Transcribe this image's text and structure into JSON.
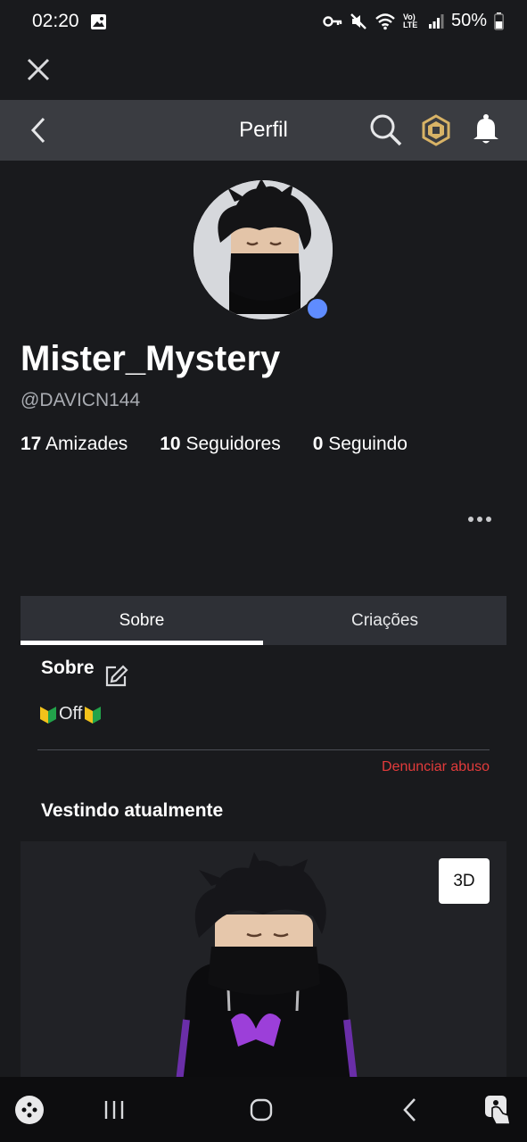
{
  "status": {
    "time": "02:20",
    "network": "Vo) LTE",
    "battery": "50%"
  },
  "header": {
    "title": "Perfil"
  },
  "profile": {
    "display_name": "Mister_Mystery",
    "username": "@DAVICN144",
    "stats": [
      {
        "count": "17",
        "label": "Amizades"
      },
      {
        "count": "10",
        "label": "Seguidores"
      },
      {
        "count": "0",
        "label": "Seguindo"
      }
    ]
  },
  "tabs": [
    {
      "label": "Sobre",
      "active": true
    },
    {
      "label": "Criações",
      "active": false
    }
  ],
  "about": {
    "title": "Sobre",
    "text": "Off",
    "report": "Denunciar abuso"
  },
  "wearing": {
    "title": "Vestindo atualmente",
    "view_button": "3D"
  },
  "colors": {
    "background": "#191a1d",
    "topnav": "#3a3c41",
    "accent_online": "#5f8cff",
    "report_red": "#e33b3b"
  }
}
